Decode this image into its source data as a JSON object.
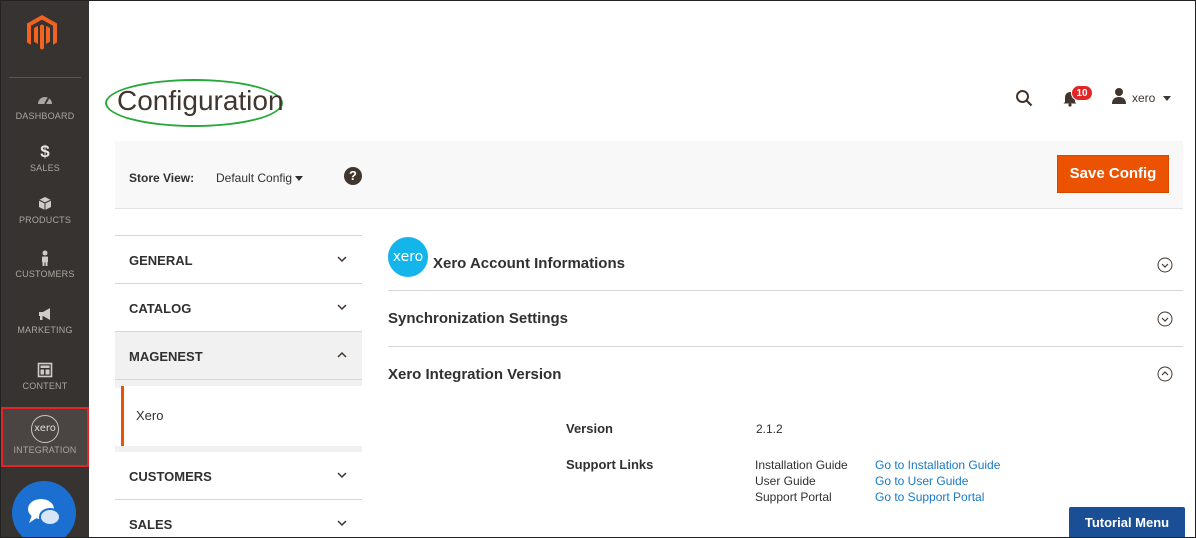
{
  "sidebar": {
    "items": [
      {
        "label": "DASHBOARD",
        "icon": "dashboard-icon"
      },
      {
        "label": "SALES",
        "icon": "dollar-icon"
      },
      {
        "label": "PRODUCTS",
        "icon": "box-icon"
      },
      {
        "label": "CUSTOMERS",
        "icon": "person-icon"
      },
      {
        "label": "MARKETING",
        "icon": "megaphone-icon"
      },
      {
        "label": "CONTENT",
        "icon": "layout-icon"
      },
      {
        "label": "INTEGRATION",
        "icon": "xero-icon",
        "icon_text": "xero"
      }
    ]
  },
  "header": {
    "title": "Configuration",
    "notifications_count": "10",
    "user_name": "xero"
  },
  "store_view": {
    "label": "Store View:",
    "value": "Default Config",
    "help": "?",
    "save_label": "Save Config"
  },
  "tabs": [
    {
      "label": "GENERAL",
      "expanded": false
    },
    {
      "label": "CATALOG",
      "expanded": false
    },
    {
      "label": "MAGENEST",
      "expanded": true,
      "children": [
        "Xero"
      ]
    },
    {
      "label": "CUSTOMERS",
      "expanded": false
    },
    {
      "label": "SALES",
      "expanded": false
    }
  ],
  "sections": [
    {
      "title": "Xero Account Informations",
      "logo_text": "xero",
      "expanded": false
    },
    {
      "title": "Synchronization Settings",
      "expanded": false
    },
    {
      "title": "Xero Integration Version",
      "expanded": true
    }
  ],
  "version_section": {
    "version_label": "Version",
    "version_value": "2.1.2",
    "support_label": "Support Links",
    "links": [
      {
        "name": "Installation Guide",
        "link": "Go to Installation Guide"
      },
      {
        "name": "User Guide",
        "link": "Go to User Guide"
      },
      {
        "name": "Support Portal",
        "link": "Go to Support Portal"
      }
    ]
  },
  "tutorial_menu": "Tutorial Menu",
  "colors": {
    "accent": "#eb5202",
    "sidebar_bg": "#373330",
    "link": "#1979c3",
    "xero": "#13b5ea",
    "highlight_box": "#e22626",
    "title_ellipse": "#27a83a"
  }
}
